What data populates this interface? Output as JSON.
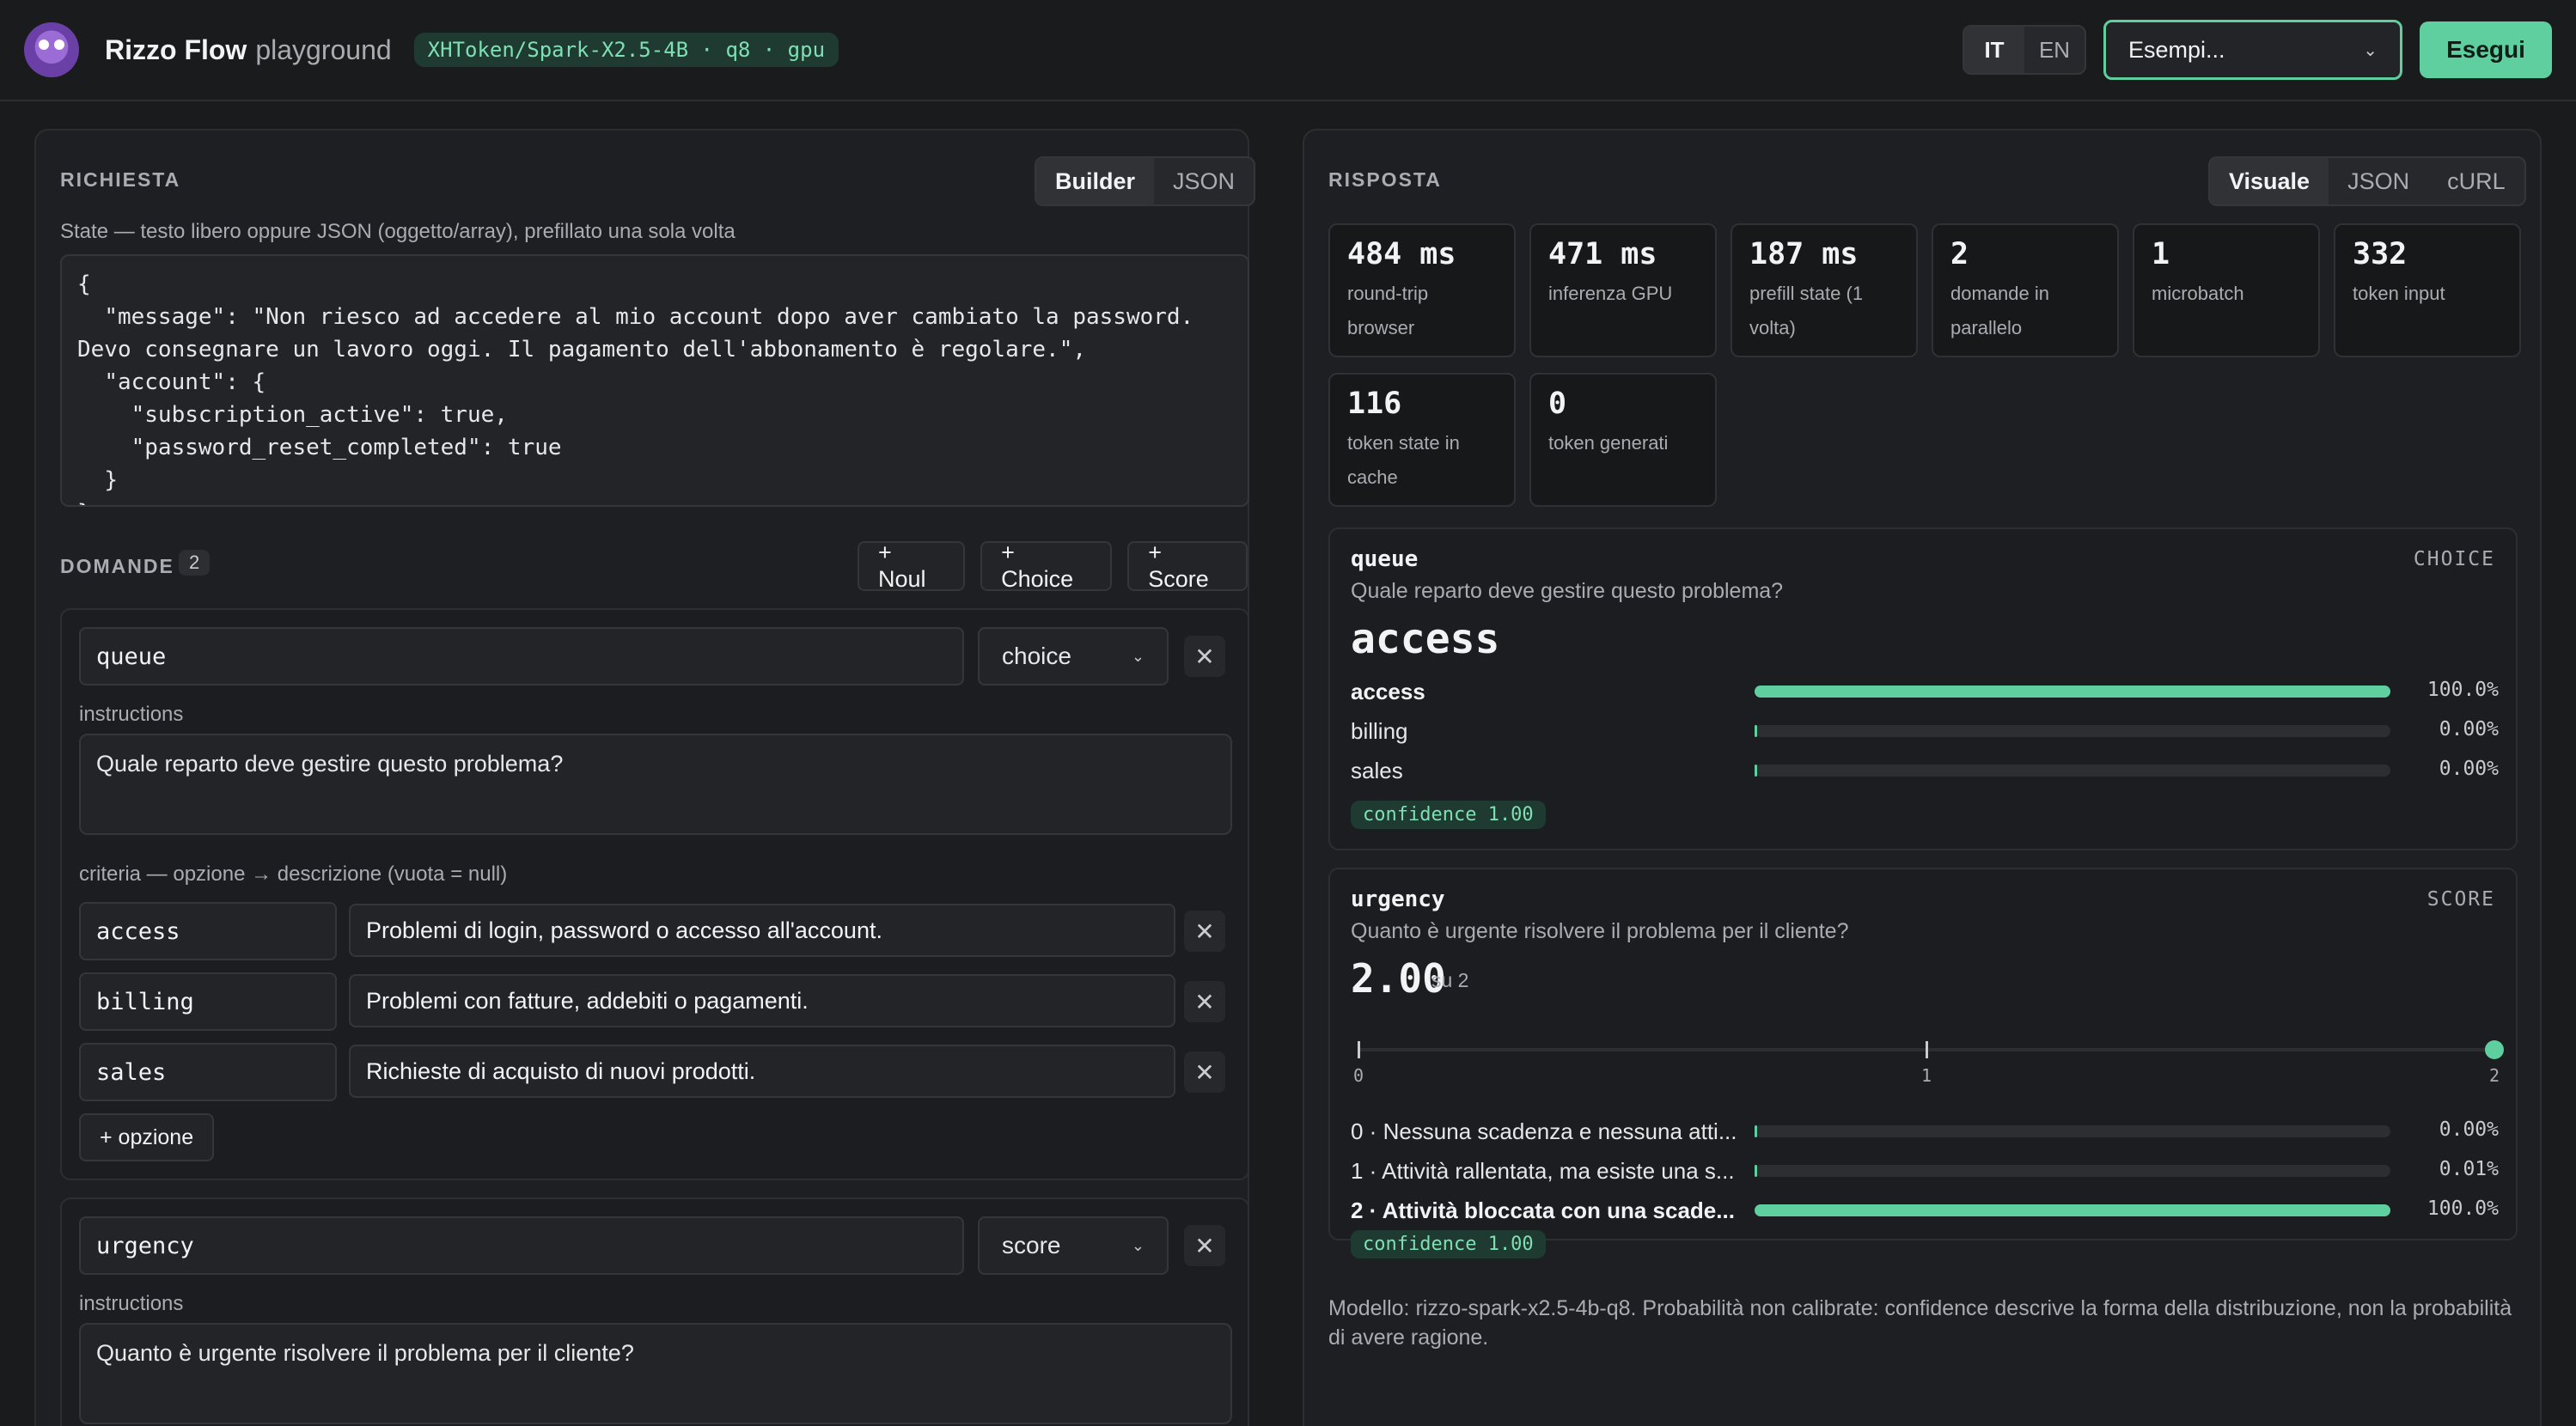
{
  "header": {
    "brand": "Rizzo Flow",
    "brand_sub": "playground",
    "model_badge": "XHToken/Spark-X2.5-4B · q8 · gpu",
    "lang": [
      "IT",
      "EN"
    ],
    "examples_placeholder": "Esempi...",
    "run_label": "Esegui"
  },
  "request": {
    "title": "RICHIESTA",
    "tabs": [
      "Builder",
      "JSON"
    ],
    "state_label": "State — testo libero oppure JSON (oggetto/array), prefillato una sola volta",
    "state_value": "{\n  \"message\": \"Non riesco ad accedere al mio account dopo aver cambiato la password. Devo consegnare un lavoro oggi. Il pagamento dell'abbonamento è regolare.\",\n  \"account\": {\n    \"subscription_active\": true,\n    \"password_reset_completed\": true\n  }\n}",
    "questions_title": "DOMANDE",
    "questions_count": "2",
    "add_buttons": [
      "+ Noul",
      "+ Choice",
      "+ Score"
    ],
    "q1": {
      "name": "queue",
      "type": "choice",
      "instructions_label": "instructions",
      "instructions": "Quale reparto deve gestire questo problema?",
      "criteria_label": "criteria — opzione → descrizione (vuota = null)",
      "options": [
        {
          "key": "access",
          "desc": "Problemi di login, password o accesso all'account."
        },
        {
          "key": "billing",
          "desc": "Problemi con fatture, addebiti o pagamenti."
        },
        {
          "key": "sales",
          "desc": "Richieste di acquisto di nuovi prodotti."
        }
      ],
      "add_option": "+ opzione"
    },
    "q2": {
      "name": "urgency",
      "type": "score",
      "instructions_label": "instructions",
      "instructions": "Quanto è urgente risolvere il problema per il cliente?"
    }
  },
  "response": {
    "title": "RISPOSTA",
    "tabs": [
      "Visuale",
      "JSON",
      "cURL"
    ],
    "stats": [
      {
        "value": "484 ms",
        "label": "round-trip browser"
      },
      {
        "value": "471 ms",
        "label": "inferenza GPU"
      },
      {
        "value": "187 ms",
        "label": "prefill state (1 volta)"
      },
      {
        "value": "2",
        "label": "domande in parallelo"
      },
      {
        "value": "1",
        "label": "microbatch"
      },
      {
        "value": "332",
        "label": "token input"
      },
      {
        "value": "116",
        "label": "token state in cache"
      },
      {
        "value": "0",
        "label": "token generati"
      }
    ],
    "queue": {
      "name": "queue",
      "type": "CHOICE",
      "question": "Quale reparto deve gestire questo problema?",
      "answer": "access",
      "rows": [
        {
          "label": "access",
          "pct": "100.0%",
          "fraction": 1.0
        },
        {
          "label": "billing",
          "pct": "0.00%",
          "fraction": 0.0
        },
        {
          "label": "sales",
          "pct": "0.00%",
          "fraction": 0.0
        }
      ],
      "confidence": "confidence 1.00"
    },
    "urgency": {
      "name": "urgency",
      "type": "SCORE",
      "question": "Quanto è urgente risolvere il problema per il cliente?",
      "score": "2.00",
      "score_of": "su 2",
      "scale": [
        "0",
        "1",
        "2"
      ],
      "score_fraction": 1.0,
      "rows": [
        {
          "label": "0 · Nessuna scadenza e nessuna atti...",
          "pct": "0.00%",
          "fraction": 0.0
        },
        {
          "label": "1 · Attività rallentata, ma esiste una s...",
          "pct": "0.01%",
          "fraction": 0.0001
        },
        {
          "label": "2 · Attività bloccata con una scade...",
          "pct": "100.0%",
          "fraction": 1.0
        }
      ],
      "confidence": "confidence 1.00"
    },
    "footnote": "Modello: rizzo-spark-x2.5-4b-q8. Probabilità non calibrate: confidence descrive la forma della distribuzione, non la probabilità di avere ragione."
  }
}
